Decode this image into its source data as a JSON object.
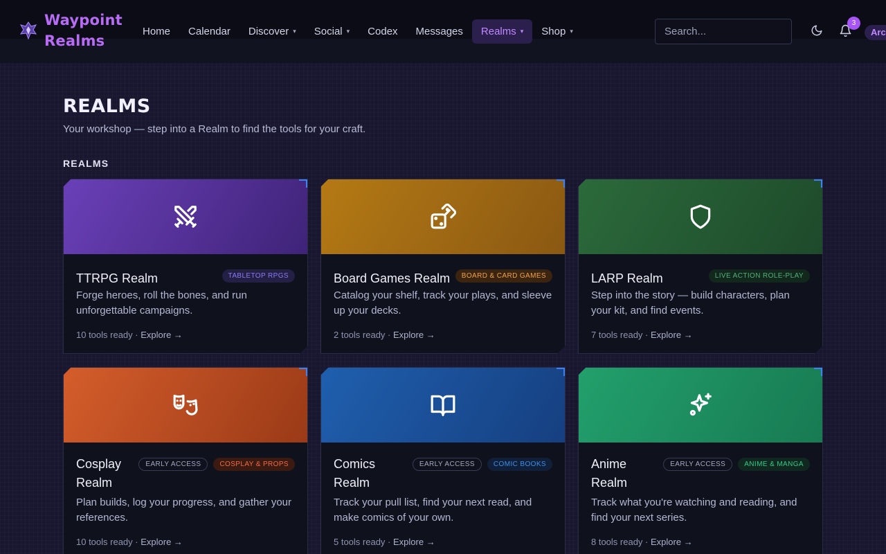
{
  "header": {
    "logo_line1": "Waypoint",
    "logo_line2": "Realms",
    "nav": [
      {
        "label": "Home",
        "chevron": false,
        "active": false
      },
      {
        "label": "Calendar",
        "chevron": false,
        "active": false
      },
      {
        "label": "Discover",
        "chevron": true,
        "active": false
      },
      {
        "label": "Social",
        "chevron": true,
        "active": false
      },
      {
        "label": "Codex",
        "chevron": false,
        "active": false
      },
      {
        "label": "Messages",
        "chevron": false,
        "active": false
      },
      {
        "label": "Realms",
        "chevron": true,
        "active": true
      },
      {
        "label": "Shop",
        "chevron": true,
        "active": false
      }
    ],
    "search_placeholder": "Search...",
    "notification_count": "3",
    "user_label": "Arc",
    "icons": {
      "theme": "moon-icon",
      "notifications": "bell-icon"
    }
  },
  "page": {
    "title": "REALMS",
    "subtitle": "Your workshop — step into a Realm to find the tools for your craft.",
    "section_label": "REALMS"
  },
  "cards": [
    {
      "name": "TTRPG Realm",
      "icon": "swords-icon",
      "tags": [
        {
          "label": "TABLETOP RPGS",
          "kind": "category",
          "color": "#8b7cf0",
          "bg": "#231f45"
        }
      ],
      "description": "Forge heroes, roll the bones, and run unforgettable campaigns.",
      "tools": "10 tools ready",
      "explore": "Explore →",
      "banner_from": "#6a40b8",
      "banner_to": "#3f2378"
    },
    {
      "name": "Board Games Realm",
      "icon": "dice-icon",
      "tags": [
        {
          "label": "BOARD & CARD GAMES",
          "kind": "category",
          "color": "#f0a24a",
          "bg": "#3b2410"
        }
      ],
      "description": "Catalog your shelf, track your plays, and sleeve up your decks.",
      "tools": "2 tools ready",
      "explore": "Explore →",
      "banner_from": "#b57a15",
      "banner_to": "#8a5812"
    },
    {
      "name": "LARP Realm",
      "icon": "shield-icon",
      "tags": [
        {
          "label": "LIVE ACTION ROLE-PLAY",
          "kind": "category",
          "color": "#53b07a",
          "bg": "#12281d"
        }
      ],
      "description": "Step into the story — build characters, plan your kit, and find events.",
      "tools": "7 tools ready",
      "explore": "Explore →",
      "banner_from": "#2b6a3a",
      "banner_to": "#1e4a2b"
    },
    {
      "name": "Cosplay Realm",
      "icon": "theater-masks-icon",
      "tags": [
        {
          "label": "EARLY ACCESS",
          "kind": "early",
          "color": "#a6a8c0",
          "bg": "transparent"
        },
        {
          "label": "COSPLAY & PROPS",
          "kind": "category",
          "color": "#f06b43",
          "bg": "#3b1a12"
        }
      ],
      "description": "Plan builds, log your progress, and gather your references.",
      "tools": "10 tools ready",
      "explore": "Explore →",
      "banner_from": "#d55d2b",
      "banner_to": "#9a3a17"
    },
    {
      "name": "Comics Realm",
      "icon": "open-book-icon",
      "tags": [
        {
          "label": "EARLY ACCESS",
          "kind": "early",
          "color": "#a6a8c0",
          "bg": "transparent"
        },
        {
          "label": "COMIC BOOKS",
          "kind": "category",
          "color": "#3f8ee8",
          "bg": "#10203a"
        }
      ],
      "description": "Track your pull list, find your next read, and make comics of your own.",
      "tools": "5 tools ready",
      "explore": "Explore →",
      "banner_from": "#1f5fae",
      "banner_to": "#163f80"
    },
    {
      "name": "Anime Realm",
      "icon": "sparkles-icon",
      "tags": [
        {
          "label": "EARLY ACCESS",
          "kind": "early",
          "color": "#a6a8c0",
          "bg": "transparent"
        },
        {
          "label": "ANIME & MANGA",
          "kind": "category",
          "color": "#34c98a",
          "bg": "#10281f"
        }
      ],
      "description": "Track what you're watching and reading, and find your next series.",
      "tools": "8 tools ready",
      "explore": "Explore →",
      "banner_from": "#22a06c",
      "banner_to": "#187a52"
    }
  ]
}
